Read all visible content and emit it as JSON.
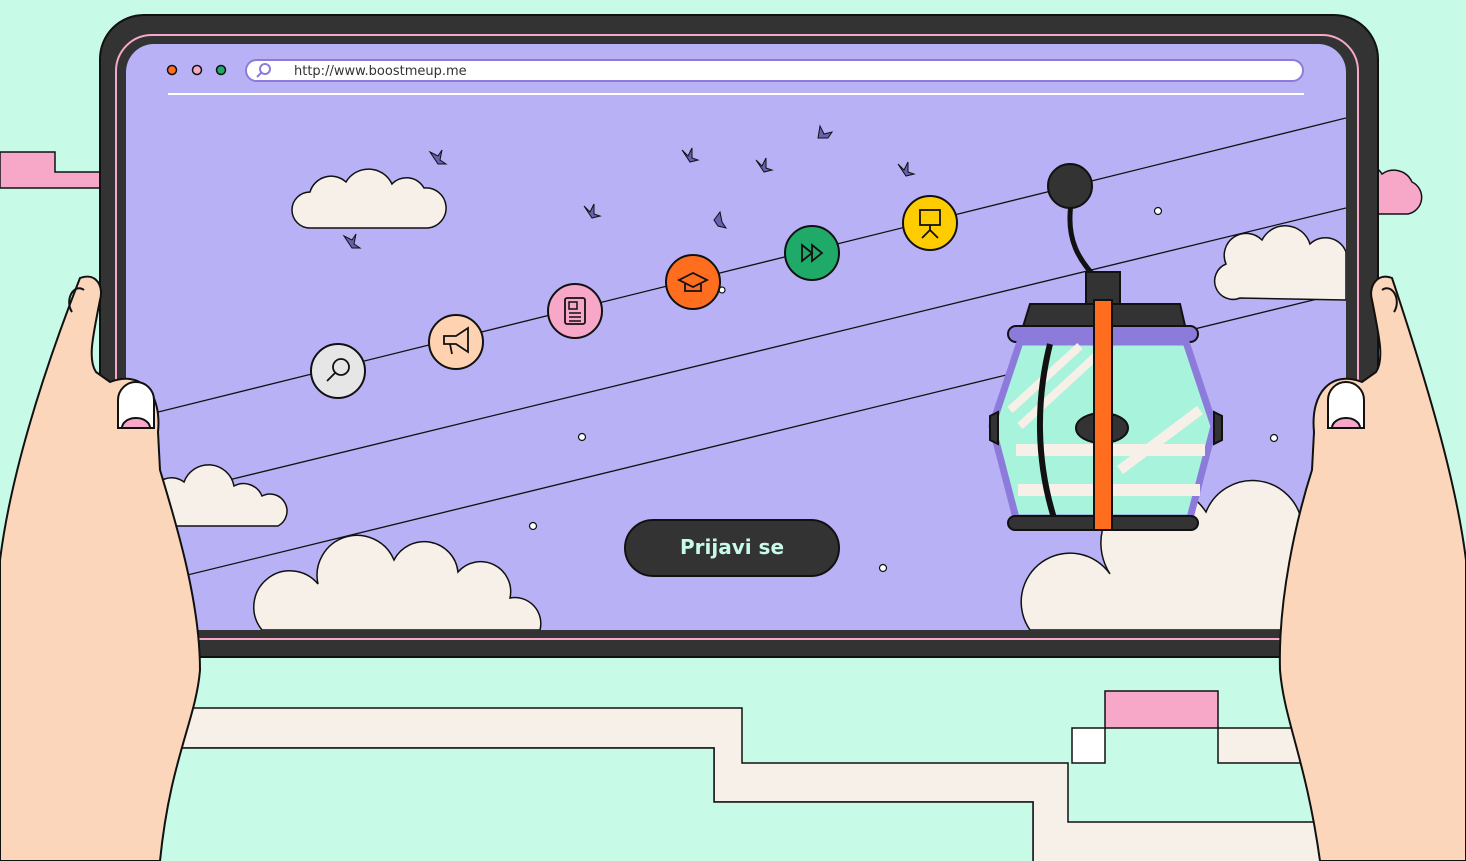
{
  "browser": {
    "url": "http://www.boostmeup.me",
    "window_dots": [
      {
        "name": "close-dot",
        "color": "#ff6d1f"
      },
      {
        "name": "minimize-dot",
        "color": "#f7a7c7"
      },
      {
        "name": "maximize-dot",
        "color": "#1faa6a"
      }
    ]
  },
  "cta": {
    "label": "Prijavi se"
  },
  "cable_icons": [
    {
      "name": "search-icon",
      "color": "#e6e6e6"
    },
    {
      "name": "megaphone-icon",
      "color": "#ffd3b2"
    },
    {
      "name": "newspaper-icon",
      "color": "#f7a7c7"
    },
    {
      "name": "graduation-cap-icon",
      "color": "#ff6d1f"
    },
    {
      "name": "fast-forward-icon",
      "color": "#1faa6a"
    },
    {
      "name": "presentation-board-icon",
      "color": "#ffcc00"
    }
  ],
  "colors": {
    "background": "#c7fbe8",
    "screen": "#b8b1f5",
    "frame": "#333333",
    "cloud": "#f6f0e8",
    "skin": "#fcd6bb",
    "cabin_glass": "#a8f3dc",
    "cabin_frame": "#8d7bdc",
    "pink": "#f7a7c7",
    "orange": "#ff6d1f"
  }
}
